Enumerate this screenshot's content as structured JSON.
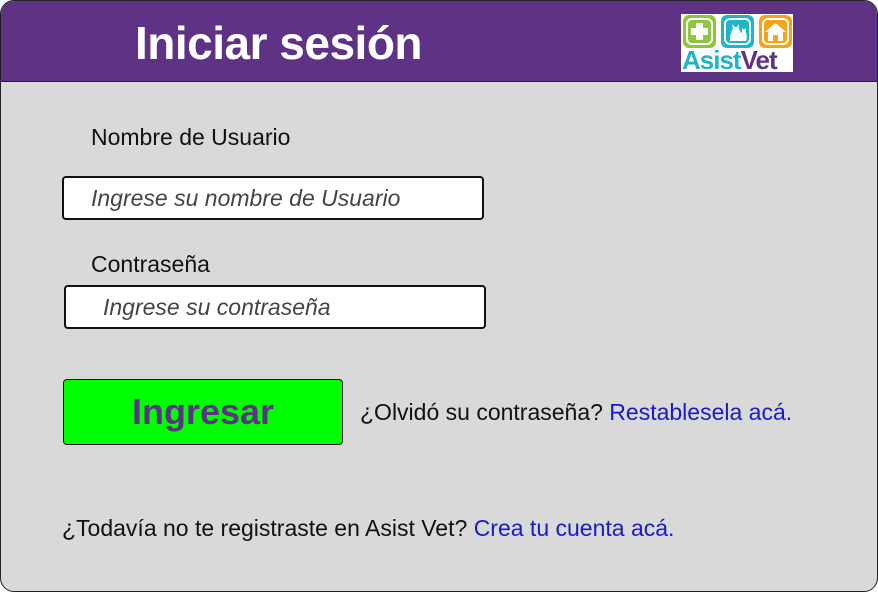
{
  "header": {
    "title": "Iniciar sesión",
    "logo": {
      "icons": [
        "plus-icon",
        "pet-icon",
        "house-icon"
      ],
      "brand_part1": "Asist",
      "brand_part2": "Vet"
    }
  },
  "form": {
    "username_label": "Nombre de Usuario",
    "username_placeholder": "Ingrese su nombre de Usuario",
    "username_value": "",
    "password_label": "Contraseña",
    "password_placeholder": "Ingrese su contraseña",
    "password_value": "",
    "submit_label": "Ingresar"
  },
  "forgot": {
    "prompt": "¿Olvidó su contraseña?",
    "link": "Restablesela acá."
  },
  "register": {
    "prompt": "¿Todavía no te registraste en Asist Vet?",
    "link": "Crea tu cuenta acá."
  },
  "colors": {
    "header_bg": "#5e3285",
    "panel_bg": "#d9d9d9",
    "button_bg": "#00ff00",
    "button_text": "#5e3285",
    "link": "#1a1ac8"
  }
}
